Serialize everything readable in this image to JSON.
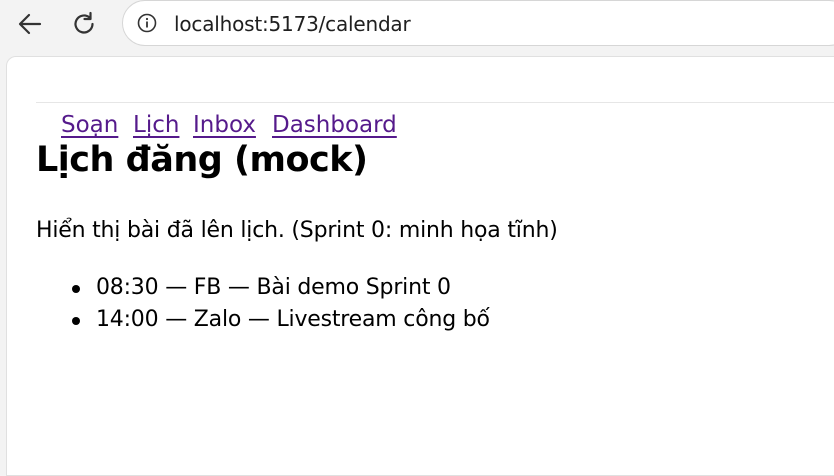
{
  "browser": {
    "url": "localhost:5173/calendar"
  },
  "nav": {
    "items": [
      {
        "label": "Soạn"
      },
      {
        "label": "Lịch"
      },
      {
        "label": "Inbox"
      },
      {
        "label": "Dashboard"
      }
    ]
  },
  "main": {
    "title": "Lịch đăng (mock)",
    "description": "Hiển thị bài đã lên lịch. (Sprint 0: minh họa tĩnh)",
    "schedule": [
      {
        "text": "08:30 — FB — Bài demo Sprint 0"
      },
      {
        "text": "14:00 — Zalo — Livestream công bố"
      }
    ]
  },
  "colors": {
    "link": "#551a8b",
    "text": "#000000",
    "chrome": "#f3f3f3"
  }
}
